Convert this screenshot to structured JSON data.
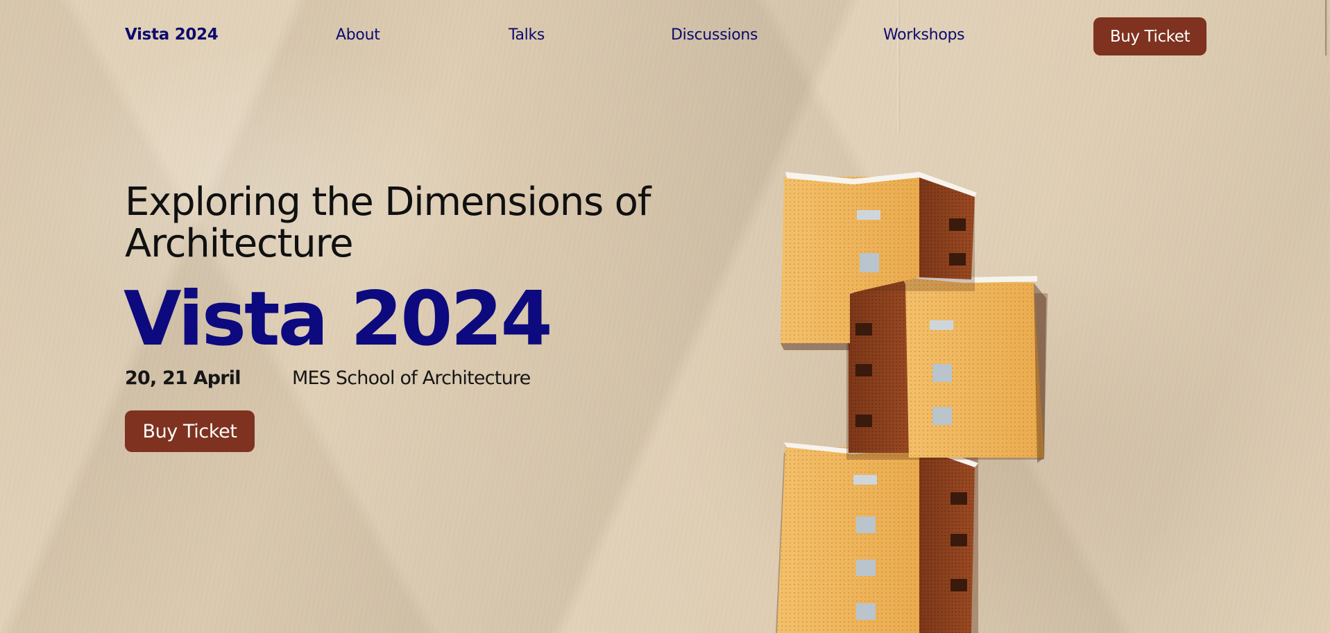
{
  "nav": {
    "brand": "Vista 2024",
    "links": [
      "About",
      "Talks",
      "Discussions",
      "Workshops"
    ],
    "cta_label": "Buy Ticket"
  },
  "hero": {
    "subtitle": "Exploring the Dimensions of Architecture",
    "title": "Vista 2024",
    "date": "20, 21 April",
    "venue": "MES School of Architecture",
    "cta_label": "Buy Ticket",
    "image": "stacked-building-illustration"
  },
  "colors": {
    "background": "#dfcdb2",
    "brand_blue": "#0c0a7e",
    "button": "#7e321f",
    "building_light": "#f1bb62",
    "building_dark": "#8a3f1e"
  }
}
